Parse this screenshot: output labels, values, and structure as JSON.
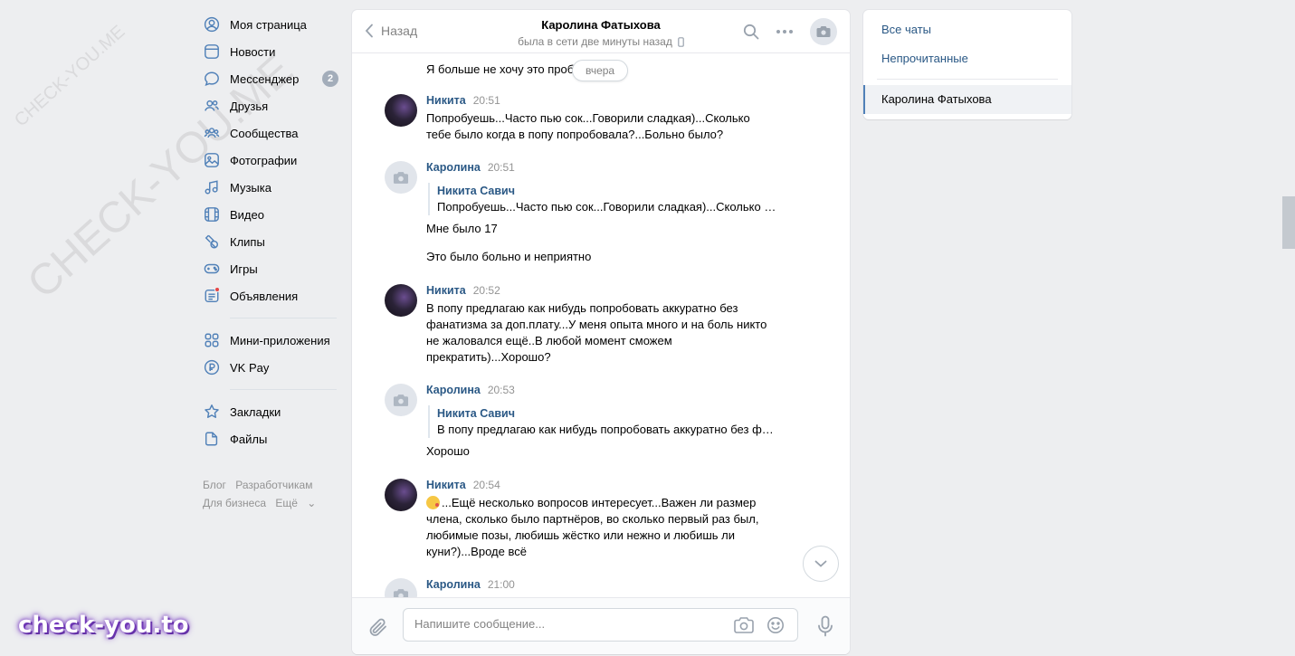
{
  "nav": {
    "items": [
      {
        "label": "Моя страница",
        "icon": "profile-icon"
      },
      {
        "label": "Новости",
        "icon": "news-icon"
      },
      {
        "label": "Мессенджер",
        "icon": "messenger-icon",
        "badge": "2"
      },
      {
        "label": "Друзья",
        "icon": "friends-icon"
      },
      {
        "label": "Сообщества",
        "icon": "communities-icon"
      },
      {
        "label": "Фотографии",
        "icon": "photos-icon"
      },
      {
        "label": "Музыка",
        "icon": "music-icon"
      },
      {
        "label": "Видео",
        "icon": "video-icon"
      },
      {
        "label": "Клипы",
        "icon": "clips-icon"
      },
      {
        "label": "Игры",
        "icon": "games-icon"
      },
      {
        "label": "Объявления",
        "icon": "ads-icon"
      }
    ],
    "items2": [
      {
        "label": "Мини-приложения",
        "icon": "mini-apps-icon"
      },
      {
        "label": "VK Pay",
        "icon": "vkpay-icon"
      }
    ],
    "items3": [
      {
        "label": "Закладки",
        "icon": "bookmarks-icon"
      },
      {
        "label": "Файлы",
        "icon": "files-icon"
      }
    ],
    "footer": {
      "blog": "Блог",
      "developers": "Разработчикам",
      "business": "Для бизнеса",
      "more": "Ещё"
    }
  },
  "chat": {
    "back_label": "Назад",
    "peer_name": "Каролина Фатыхова",
    "peer_status": "была в сети две минуты назад",
    "first_line": "Я больше не хочу это проб",
    "date_pill": "вчера",
    "messages": [
      {
        "author": "Никита",
        "time": "20:51",
        "text": "Попробуешь...Часто пью сок...Говорили сладкая)...Сколько\nтебе было когда в попу попробовала?...Больно было?"
      },
      {
        "author": "Каролина",
        "time": "20:51",
        "quote_author": "Никита Савич",
        "quote_text": "Попробуешь...Часто пью сок...Говорили сладкая)...Сколько тебе было когда в попу попробовала?...Больно было?",
        "text": "Мне было 17",
        "text2": "Это было больно и неприятно"
      },
      {
        "author": "Никита",
        "time": "20:52",
        "text": "В попу предлагаю как нибудь попробовать аккуратно без\nфанатизма за доп.плату...У меня опыта много и на боль никто\nне жаловался ещё..В любой момент сможем\nпрекратить)...Хорошо?"
      },
      {
        "author": "Каролина",
        "time": "20:53",
        "quote_author": "Никита Савич",
        "quote_text": "В попу предлагаю как нибудь попробовать аккуратно без фанатизма за доп.плату...",
        "text": "Хорошо"
      },
      {
        "author": "Никита",
        "time": "20:54",
        "text": "...Ещё несколько вопросов интересует...Важен ли размер\nчлена, сколько было партнёров, во сколько первый раз был,\nлюбимые позы, любишь жёстко или нежно и любишь ли\nкуни?)...Вроде всё"
      },
      {
        "author": "Каролина",
        "time": "21:00"
      }
    ],
    "composer_placeholder": "Напишите сообщение..."
  },
  "right": {
    "all_chats": "Все чаты",
    "unread": "Непрочитанные",
    "active_chat": "Каролина Фатыхова"
  },
  "watermark": {
    "small": "CHECK-YOU.ME",
    "large": "CHECK-YOU.ME",
    "logo": "check-you.to"
  },
  "colors": {
    "link": "#2a5885",
    "accent": "#5181b8",
    "background": "#edeef0"
  }
}
